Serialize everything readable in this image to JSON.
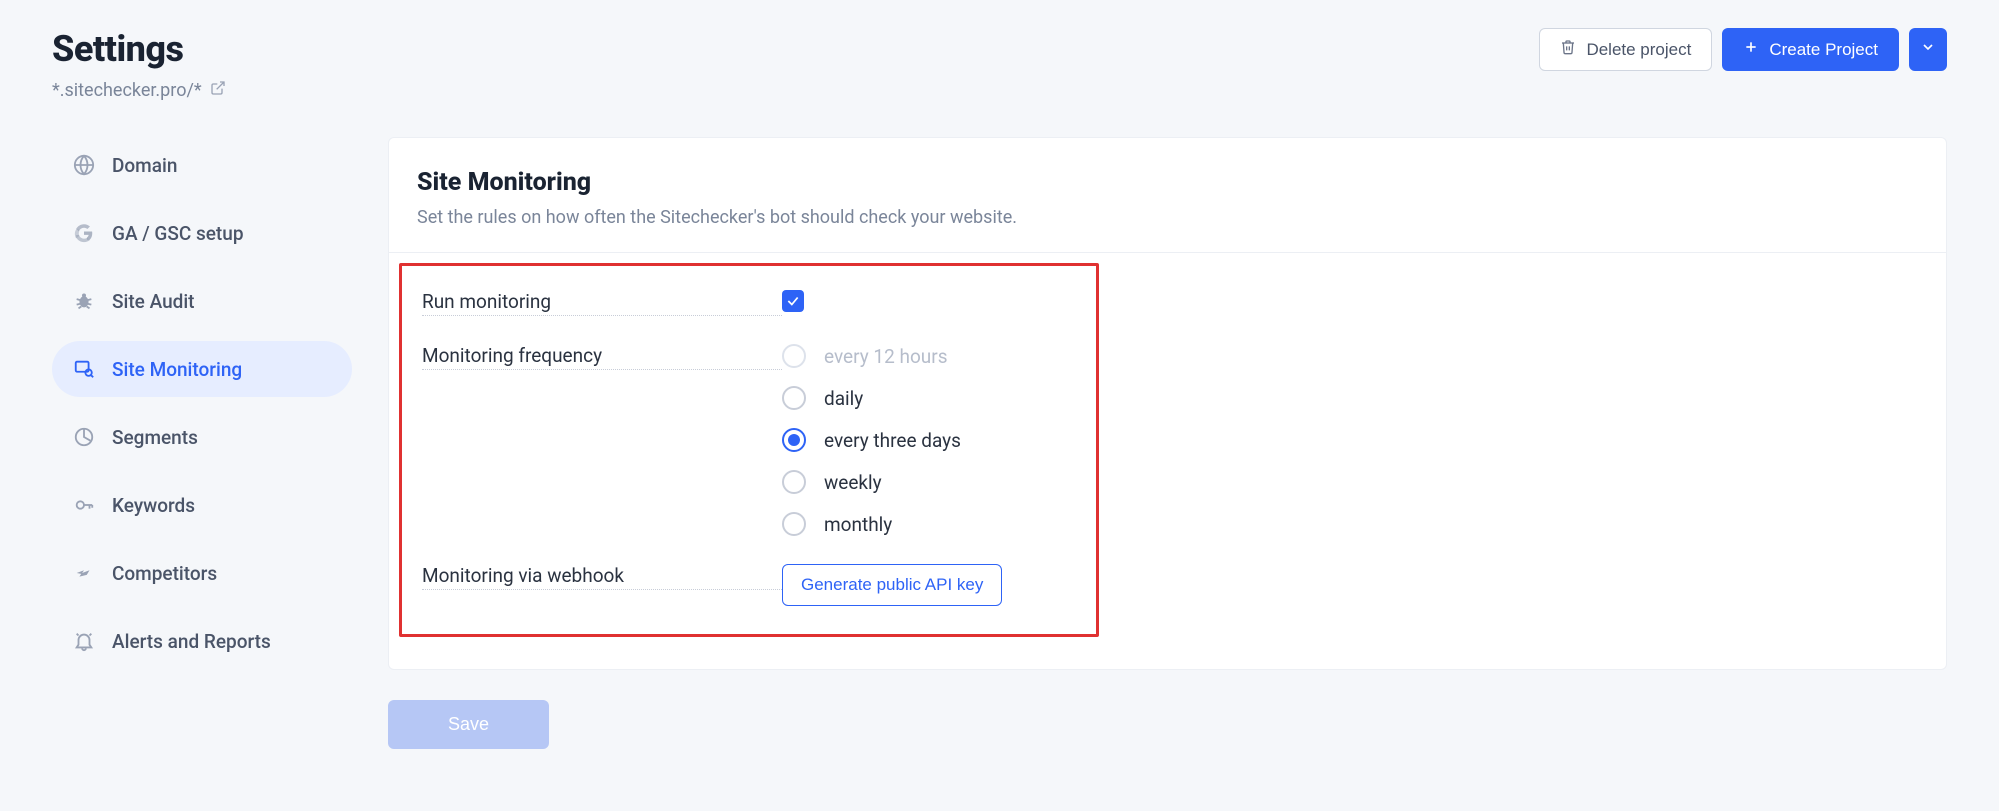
{
  "header": {
    "title": "Settings",
    "subtitle": "*.sitechecker.pro/*",
    "delete_label": "Delete project",
    "create_label": "Create Project"
  },
  "sidebar": {
    "items": [
      {
        "label": "Domain"
      },
      {
        "label": "GA / GSC setup"
      },
      {
        "label": "Site Audit"
      },
      {
        "label": "Site Monitoring"
      },
      {
        "label": "Segments"
      },
      {
        "label": "Keywords"
      },
      {
        "label": "Competitors"
      },
      {
        "label": "Alerts and Reports"
      }
    ],
    "active_index": 3
  },
  "main": {
    "section_title": "Site Monitoring",
    "section_desc": "Set the rules on how often the Sitechecker's bot should check your website.",
    "labels": {
      "run_monitoring": "Run monitoring",
      "frequency": "Monitoring frequency",
      "webhook": "Monitoring via webhook"
    },
    "run_monitoring_checked": true,
    "frequency_options": [
      {
        "label": "every 12 hours",
        "disabled": true,
        "selected": false
      },
      {
        "label": "daily",
        "disabled": false,
        "selected": false
      },
      {
        "label": "every three days",
        "disabled": false,
        "selected": true
      },
      {
        "label": "weekly",
        "disabled": false,
        "selected": false
      },
      {
        "label": "monthly",
        "disabled": false,
        "selected": false
      }
    ],
    "api_button": "Generate public API key",
    "save": "Save"
  }
}
